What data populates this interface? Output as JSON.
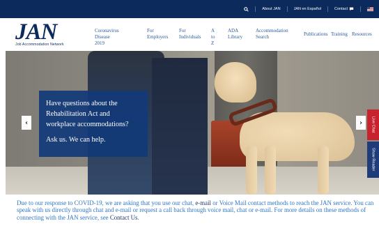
{
  "topbar": {
    "search_icon": "search-icon",
    "about": "About JAN",
    "espanol": "JAN en Español",
    "contact": "Contact",
    "contact_icon": "chat-icon",
    "flag_icon": "us-flag-icon"
  },
  "header": {
    "logo_text": "JAN",
    "logo_sub": "Job Accommodation Network",
    "nav": [
      {
        "line1": "Coronavirus",
        "line2": "Disease 2019"
      },
      {
        "line1": "For",
        "line2": "Employers"
      },
      {
        "line1": "For",
        "line2": "Individuals"
      },
      {
        "line1": "A to",
        "line2": "Z"
      },
      {
        "line1": "ADA",
        "line2": "Library"
      },
      {
        "line1": "Accommodation",
        "line2": "Search"
      },
      {
        "line1": "Publications",
        "line2": ""
      },
      {
        "line1": "Training",
        "line2": ""
      },
      {
        "line1": "Resources",
        "line2": ""
      }
    ]
  },
  "hero": {
    "question": "Have questions about the Rehabilitation Act and workplace accommodations?",
    "answer": "Ask us. We can help.",
    "prev": "‹",
    "next": "›"
  },
  "side_tabs": {
    "live_chat": "Live Chat",
    "show_reader": "Show Reader"
  },
  "notice": {
    "part1": "Due to our response to COVID-19, we are asking that you use our chat, ",
    "email": "e-mail",
    "part2": " or Voice Mail contact methods to reach the JAN service. You can speak with us directly through chat and e-mail or request a call back through voice mail, chat or e-mail. For more details on these methods of connecting with the JAN service, see ",
    "contact": "Contact Us",
    "end": "."
  },
  "colors": {
    "navy": "#0d2a5c",
    "link_blue": "#2b5a9b",
    "callout": "#123a78",
    "chat_red": "#c8222f"
  }
}
